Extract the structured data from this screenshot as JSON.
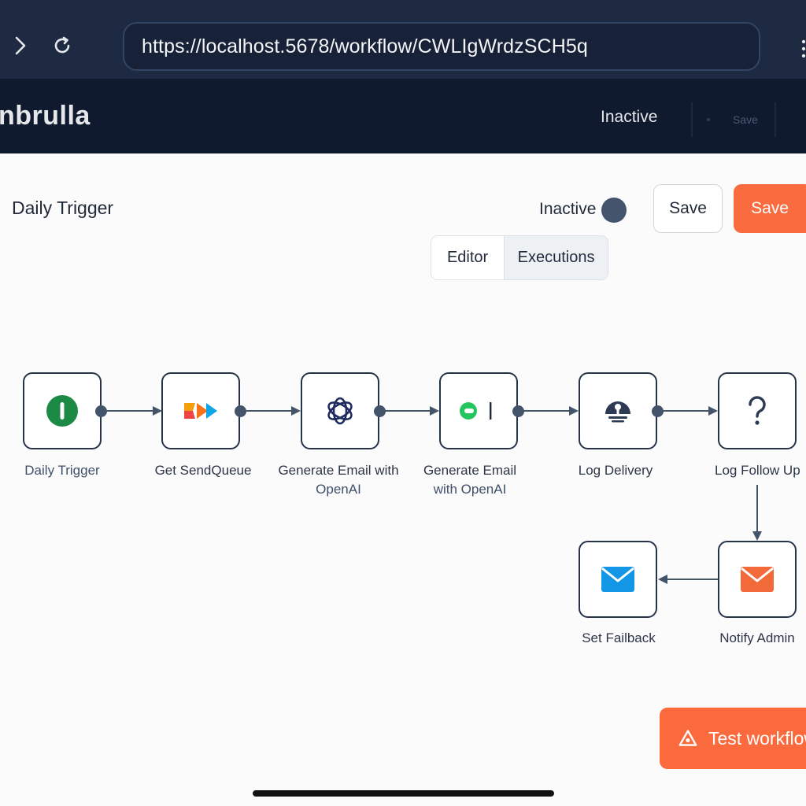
{
  "browser": {
    "url": "https://localhost.5678/workflow/CWLIgWrdzSCH5q",
    "forward_icon": "chevron-right-icon",
    "reload_icon": "reload-icon"
  },
  "app_header": {
    "brand": "nbrulla",
    "status": "Inactive",
    "save": "Save"
  },
  "toolbar": {
    "workflow_name": "Daily Trigger",
    "status_label": "Inactive",
    "save_outline": "Save",
    "save_primary": "Save"
  },
  "tabs": [
    {
      "label": "Editor"
    },
    {
      "label": "Executions"
    }
  ],
  "nodes": [
    {
      "icon": "power-icon",
      "label_line1": "Daily Trigger",
      "label_line2": ""
    },
    {
      "icon": "send-icon",
      "label_line1": "Get SendQueue",
      "label_line2": ""
    },
    {
      "icon": "openai-icon",
      "label_line1": "Generate Email with",
      "label_line2": "OpenAI"
    },
    {
      "icon": "chat-icon",
      "label_line1": "Generate Email",
      "label_line2": "with OpenAI"
    },
    {
      "icon": "database-icon",
      "label_line1": "Log Delivery",
      "label_line2": ""
    },
    {
      "icon": "question-icon",
      "label_line1": "Log Follow Up",
      "label_line2": ""
    },
    {
      "icon": "mail-blue-icon",
      "label_line1": "Set Failback",
      "label_line2": ""
    },
    {
      "icon": "mail-orange-icon",
      "label_line1": "Notify Admin",
      "label_line2": ""
    }
  ],
  "test_button": {
    "label": "Test workflow",
    "icon": "flask-icon"
  },
  "colors": {
    "accent": "#fa6c3f",
    "chrome": "#1d2a42",
    "header": "#0f1a2e",
    "node_border": "#263449"
  }
}
